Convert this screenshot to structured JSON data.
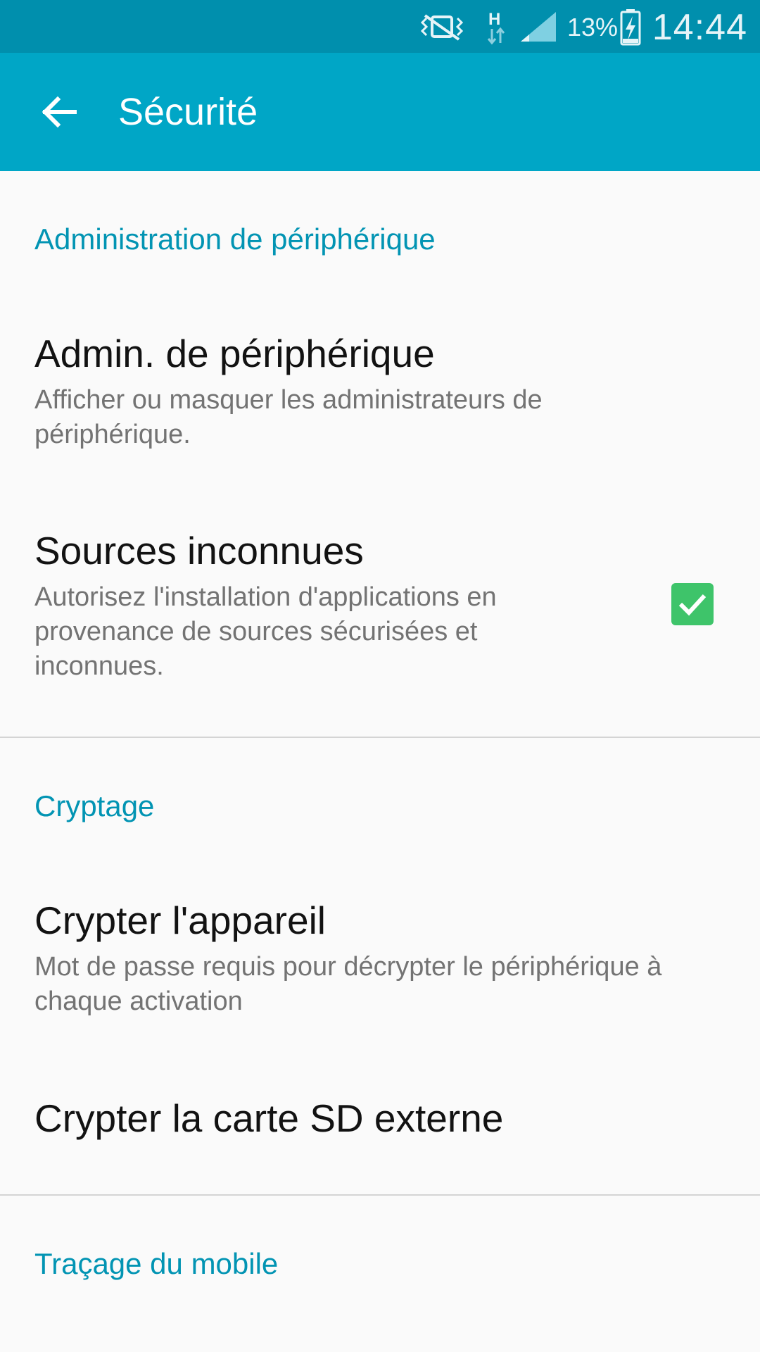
{
  "status_bar": {
    "icons": [
      "vibrate-mute-icon",
      "hspa-data-icon",
      "signal-icon",
      "battery-charging-icon"
    ],
    "battery_percent": "13%",
    "time": "14:44"
  },
  "app_bar": {
    "back_icon": "arrow-left-icon",
    "title": "Sécurité"
  },
  "sections": [
    {
      "header": "Administration de périphérique",
      "items": [
        {
          "title": "Admin. de périphérique",
          "summary": "Afficher ou masquer les administrateurs de périphérique."
        },
        {
          "title": "Sources inconnues",
          "summary": "Autorisez l'installation d'applications en provenance de sources sécurisées et inconnues.",
          "checked": true
        }
      ]
    },
    {
      "header": "Cryptage",
      "items": [
        {
          "title": "Crypter l'appareil",
          "summary": "Mot de passe requis pour décrypter le périphérique à chaque activation"
        },
        {
          "title": "Crypter la carte SD externe"
        }
      ]
    },
    {
      "header": "Traçage du mobile",
      "items": []
    }
  ],
  "colors": {
    "status_bar": "#008fad",
    "app_bar": "#00a6c6",
    "accent": "#0294b3",
    "checkbox": "#3ec46a"
  }
}
